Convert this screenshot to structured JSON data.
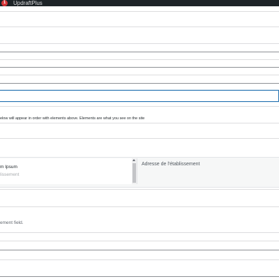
{
  "admin_bar": {
    "badge_count": "1",
    "title": "UpdraftPlus"
  },
  "notice": {
    "text": "elow will appear in  order with elements above. Elements are what you see on the site"
  },
  "element_list": {
    "item_title": "m Ipsum",
    "item_subtitle": "lissement"
  },
  "address_field": {
    "label": "Adresse de l'établissement"
  },
  "field_description": {
    "text": "ement field."
  },
  "colors": {
    "admin_bar": "#1d2327",
    "accent": "#2271b1",
    "badge": "#d63638"
  }
}
